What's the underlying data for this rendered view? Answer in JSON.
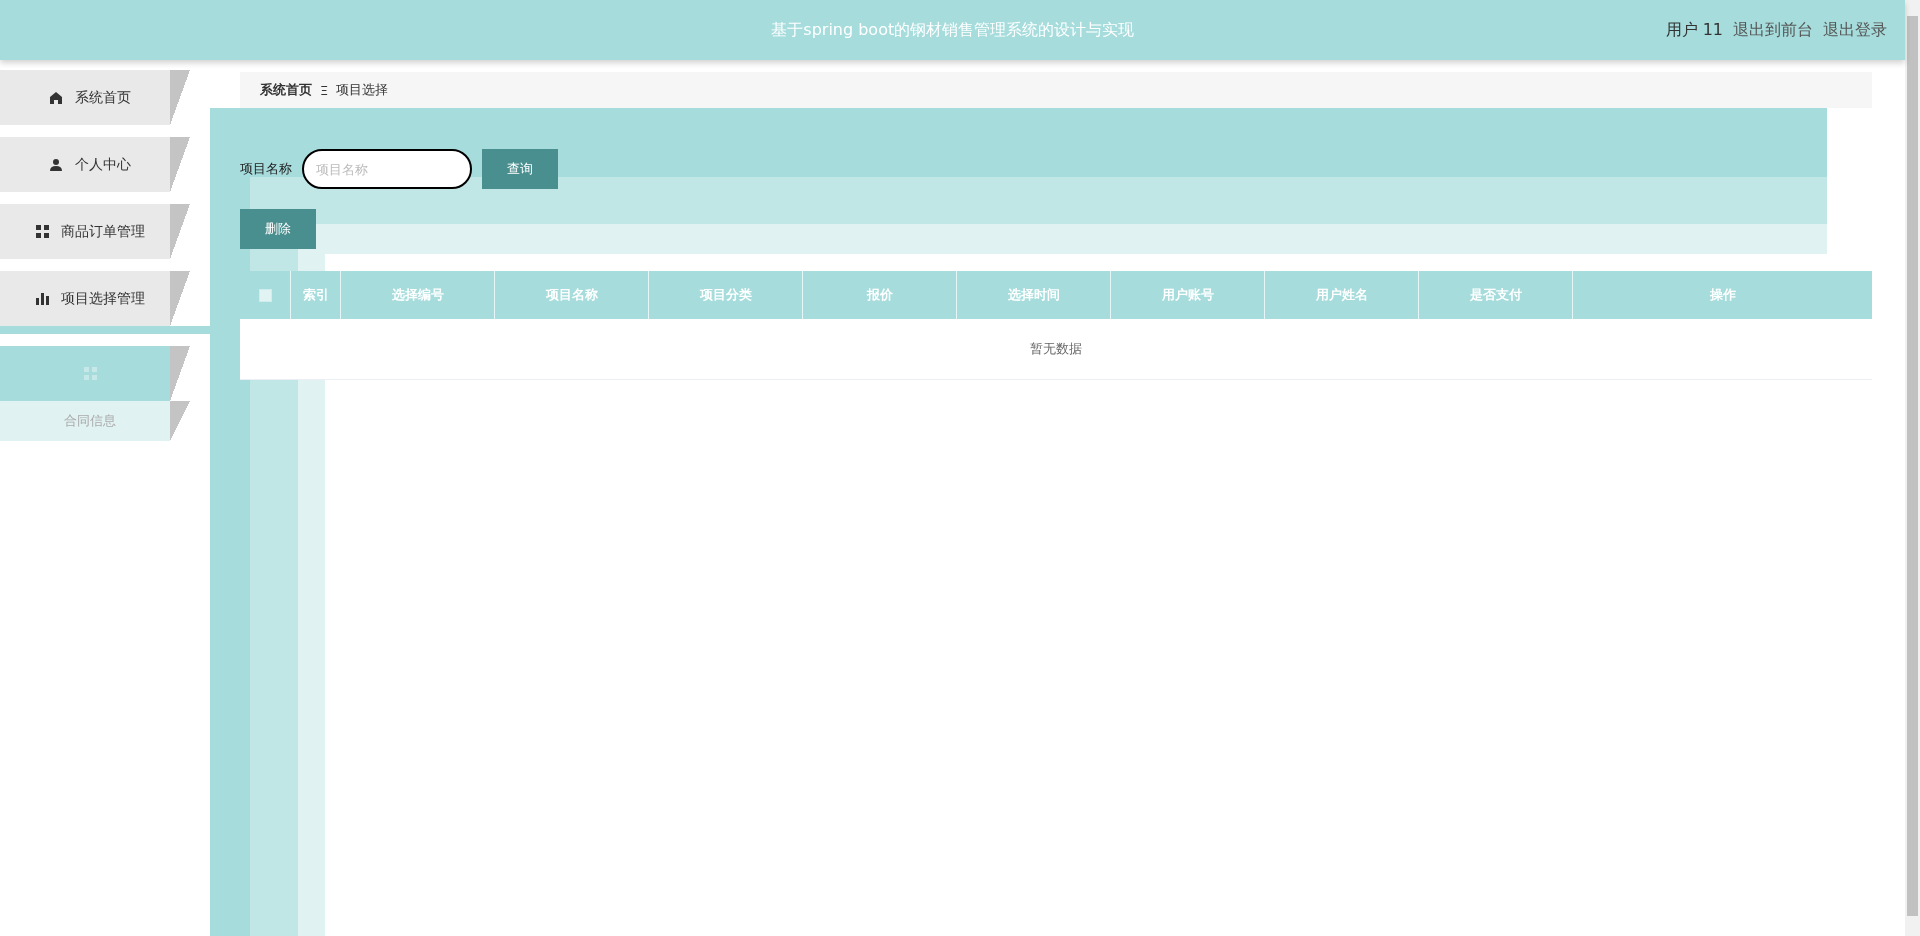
{
  "header": {
    "title": "基于spring boot的钢材销售管理系统的设计与实现",
    "user": "用户 11",
    "links": [
      "退出到前台",
      "退出登录"
    ]
  },
  "sidebar": {
    "items": [
      {
        "label": "系统首页",
        "selected": false,
        "expanded": false
      },
      {
        "label": "个人中心",
        "selected": false,
        "expanded": false
      },
      {
        "label": "商品订单管理",
        "selected": false,
        "expanded": false
      },
      {
        "label": "项目选择管理",
        "selected": true,
        "expanded": false
      },
      {
        "selected": false,
        "expanded": true,
        "children": [
          {
            "label": "合同信息"
          }
        ]
      }
    ]
  },
  "breadcrumb": {
    "items": [
      "系统首页",
      "项目选择"
    ],
    "separator": "Ξ"
  },
  "search": {
    "label": "项目名称",
    "placeholder": "项目名称",
    "button": "查询"
  },
  "actions": [
    "删除"
  ],
  "table": {
    "select_all": {
      "checked": false
    },
    "columns": [
      "索引",
      "选择编号",
      "项目名称",
      "项目分类",
      "报价",
      "选择时间",
      "用户账号",
      "用户姓名",
      "是否支付",
      "操作"
    ],
    "empty_text": "暂无数据"
  }
}
